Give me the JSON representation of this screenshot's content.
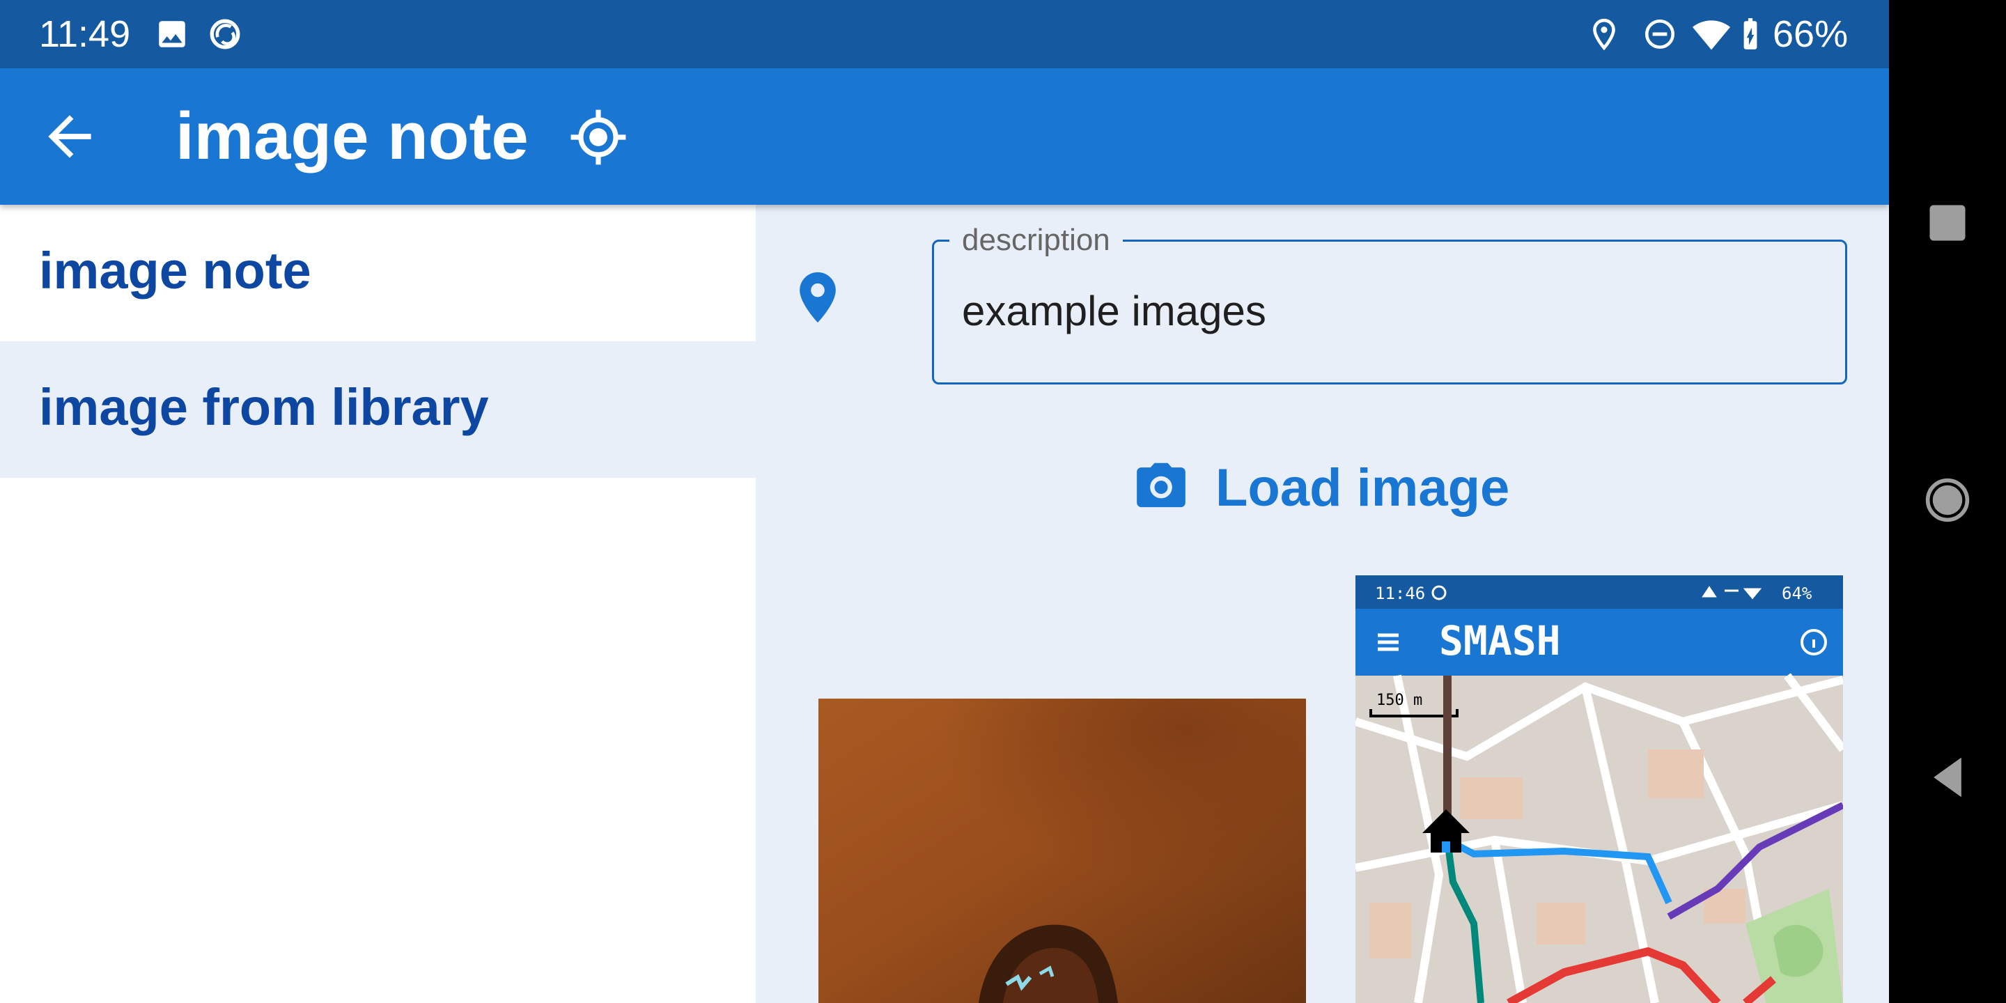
{
  "status_bar": {
    "time": "11:49",
    "battery": "66%",
    "icons": [
      "image-icon",
      "sync-icon",
      "location-pin-icon",
      "do-not-disturb-icon",
      "wifi-icon",
      "battery-charging-icon"
    ]
  },
  "app_bar": {
    "title": "image note",
    "back_icon": "arrow-back-icon",
    "action_icon": "gps-target-icon"
  },
  "sidebar": {
    "items": [
      {
        "label": "image note",
        "selected": false
      },
      {
        "label": "image from library",
        "selected": true
      }
    ]
  },
  "form": {
    "description": {
      "label": "description",
      "value": "example images"
    },
    "load_image": {
      "label": "Load image",
      "icon": "camera-icon"
    }
  },
  "thumbnails": [
    {
      "kind": "photo"
    },
    {
      "kind": "screenshot",
      "status_time": "11:46",
      "status_battery": "64%",
      "app_title": "SMASH",
      "scale_label": "150 m"
    }
  ],
  "nav_bar": {
    "buttons": [
      "recents-square-icon",
      "home-circle-icon",
      "back-triangle-icon"
    ]
  },
  "colors": {
    "status_bar": "#155aa0",
    "app_bar": "#1976d2",
    "accent_text": "#0d47a1",
    "main_background": "#e8eff9"
  }
}
